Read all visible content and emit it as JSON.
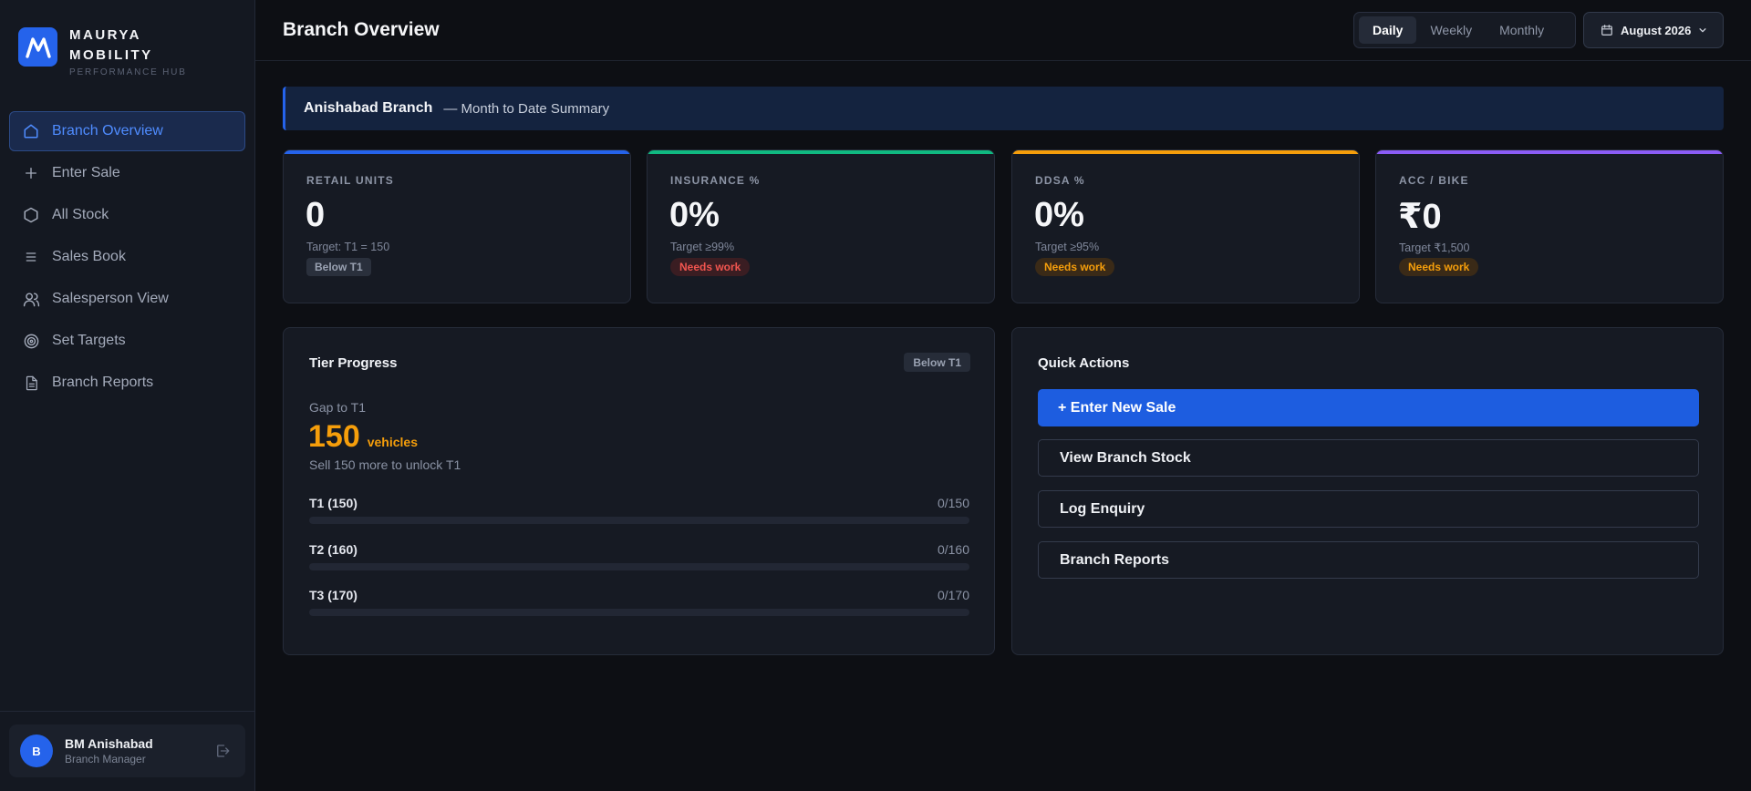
{
  "brand": {
    "name": "MAURYA MOBILITY",
    "subtitle": "PERFORMANCE HUB",
    "logo_letter": "M",
    "color": "#2563eb"
  },
  "nav": {
    "items": [
      {
        "label": "Branch Overview",
        "icon": "home-icon",
        "active": true
      },
      {
        "label": "Enter Sale",
        "icon": "plus-icon",
        "active": false
      },
      {
        "label": "All Stock",
        "icon": "hexagon-icon",
        "active": false
      },
      {
        "label": "Sales Book",
        "icon": "list-icon",
        "active": false
      },
      {
        "label": "Salesperson View",
        "icon": "users-icon",
        "active": false
      },
      {
        "label": "Set Targets",
        "icon": "target-icon",
        "active": false
      },
      {
        "label": "Branch Reports",
        "icon": "file-icon",
        "active": false
      }
    ]
  },
  "user": {
    "initial": "B",
    "name": "BM Anishabad",
    "role": "Branch Manager"
  },
  "header": {
    "title": "Branch Overview",
    "periods": [
      "Daily",
      "Weekly",
      "Monthly"
    ],
    "active_period": "Daily",
    "month": "August 2026"
  },
  "banner": {
    "branch": "Anishabad Branch",
    "subtitle": "— Month to Date Summary"
  },
  "kpis": [
    {
      "label": "RETAIL UNITS",
      "value": "0",
      "target": "Target: T1 = 150",
      "badge": "Below T1",
      "badge_style": "gray",
      "accent": "#2563eb"
    },
    {
      "label": "INSURANCE %",
      "value": "0%",
      "target": "Target ≥99%",
      "badge": "Needs work",
      "badge_style": "red",
      "accent": "#10b981"
    },
    {
      "label": "DDSA %",
      "value": "0%",
      "target": "Target ≥95%",
      "badge": "Needs work",
      "badge_style": "orange",
      "accent": "#f59e0b"
    },
    {
      "label": "ACC / BIKE",
      "value": "₹0",
      "target": "Target ₹1,500",
      "badge": "Needs work",
      "badge_style": "orange",
      "accent": "#8b5cf6"
    }
  ],
  "tier_progress": {
    "title": "Tier Progress",
    "badge": "Below T1",
    "gap_label": "Gap to T1",
    "gap_value": "150",
    "gap_unit": "vehicles",
    "gap_note": "Sell 150 more to unlock T1",
    "tiers": [
      {
        "name": "T1 (150)",
        "count": "0/150",
        "progress": 0
      },
      {
        "name": "T2 (160)",
        "count": "0/160",
        "progress": 0
      },
      {
        "name": "T3 (170)",
        "count": "0/170",
        "progress": 0
      }
    ]
  },
  "quick_actions": {
    "title": "Quick Actions",
    "buttons": [
      {
        "label": "+ Enter New Sale",
        "primary": true
      },
      {
        "label": "View Branch Stock",
        "primary": false
      },
      {
        "label": "Log Enquiry",
        "primary": false
      },
      {
        "label": "Branch Reports",
        "primary": false
      }
    ]
  }
}
